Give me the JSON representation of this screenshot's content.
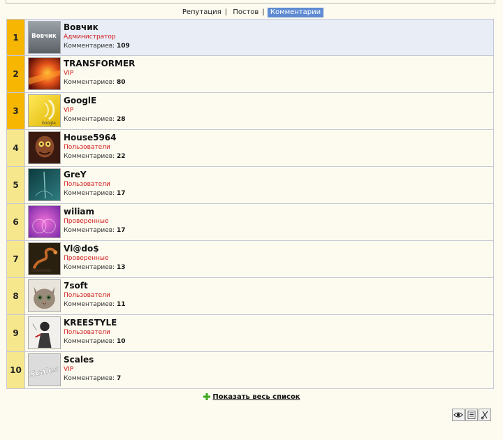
{
  "tabs": [
    {
      "label": "Репутация",
      "active": false
    },
    {
      "label": "Постов",
      "active": false
    },
    {
      "label": "Комментарии",
      "active": true
    }
  ],
  "tab_separator": "|",
  "count_label": "Комментариев:",
  "users": [
    {
      "rank": "1",
      "name": "Вовчик",
      "group": "Администратор",
      "count": "109",
      "avatar_text": "Вовчик"
    },
    {
      "rank": "2",
      "name": "TRANSFORMER",
      "group": "VIP",
      "count": "80"
    },
    {
      "rank": "3",
      "name": "GooglE",
      "group": "VIP",
      "count": "28",
      "avatar_text": "Google"
    },
    {
      "rank": "4",
      "name": "House5964",
      "group": "Пользователи",
      "count": "22"
    },
    {
      "rank": "5",
      "name": "GreY",
      "group": "Пользователи",
      "count": "17"
    },
    {
      "rank": "6",
      "name": "wiliam",
      "group": "Проверенные",
      "count": "17"
    },
    {
      "rank": "7",
      "name": "Vl@do$",
      "group": "Проверенные",
      "count": "13"
    },
    {
      "rank": "8",
      "name": "7soft",
      "group": "Пользователи",
      "count": "11"
    },
    {
      "rank": "9",
      "name": "KREESTYLE",
      "group": "Пользователи",
      "count": "10"
    },
    {
      "rank": "10",
      "name": "Scales",
      "group": "VIP",
      "count": "7",
      "avatar_text": "Scales"
    }
  ],
  "show_all_label": "Показать весь список",
  "tools": [
    {
      "icon": "eye-icon"
    },
    {
      "icon": "list-icon"
    },
    {
      "icon": "scissors-icon"
    }
  ],
  "colors": {
    "gold_rank": "#f6b602",
    "pale_rank": "#f6e78d",
    "active_tab": "#5e8bd3",
    "group_text": "#d11a1a",
    "first_row_bg": "#e8edf6"
  }
}
